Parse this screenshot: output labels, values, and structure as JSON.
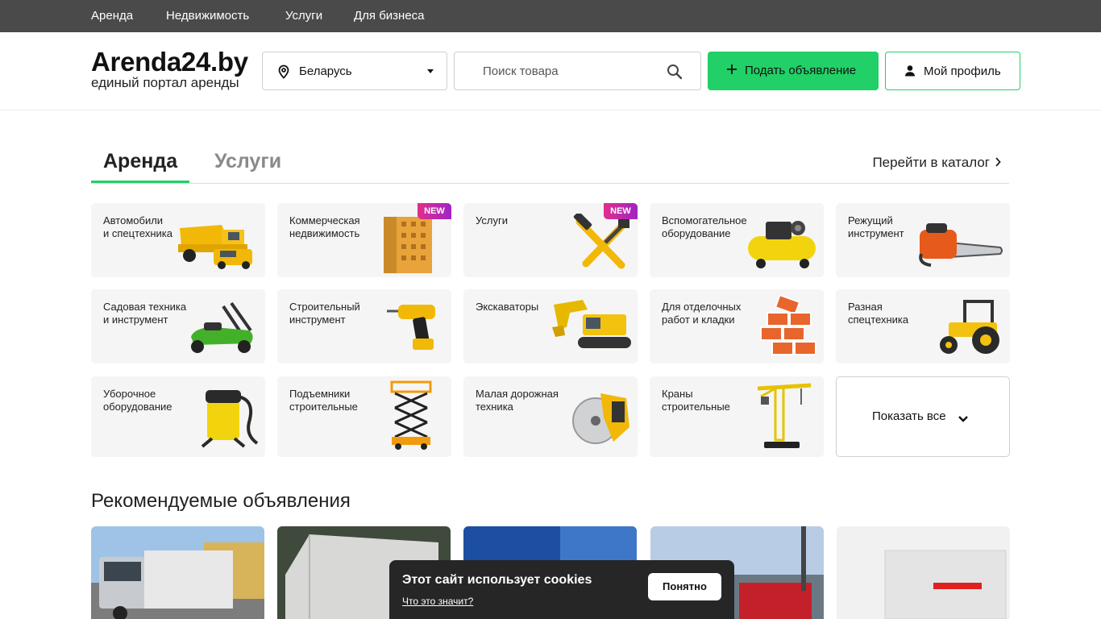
{
  "topnav": {
    "items": [
      "Аренда",
      "Недвижимость",
      "Услуги",
      "Для бизнеса"
    ]
  },
  "header": {
    "logo_title": "Arenda24.by",
    "logo_subtitle": "единый портал аренды",
    "region": "Беларусь",
    "search_placeholder": "Поиск товара",
    "post_button": "Подать объявление",
    "profile_button": "Мой профиль"
  },
  "tabs": {
    "items": [
      "Аренда",
      "Услуги"
    ],
    "active": "Аренда",
    "catalog_link": "Перейти в каталог"
  },
  "categories": [
    {
      "label": "Автомобили\nи спецтехника",
      "icon": "dump-truck-icon",
      "badge": ""
    },
    {
      "label": "Коммерческая\nнедвижимость",
      "icon": "building-icon",
      "badge": "NEW"
    },
    {
      "label": "Услуги",
      "icon": "tools-icon",
      "badge": "NEW"
    },
    {
      "label": "Вспомогательное\nоборудование",
      "icon": "compressor-icon",
      "badge": ""
    },
    {
      "label": "Режущий\nинструмент",
      "icon": "chainsaw-icon",
      "badge": ""
    },
    {
      "label": "Садовая техника\nи инструмент",
      "icon": "lawn-mower-icon",
      "badge": ""
    },
    {
      "label": "Строительный\nинструмент",
      "icon": "drill-icon",
      "badge": ""
    },
    {
      "label": "Экскаваторы",
      "icon": "excavator-icon",
      "badge": ""
    },
    {
      "label": "Для отделочных\nработ и кладки",
      "icon": "bricks-icon",
      "badge": ""
    },
    {
      "label": "Разная\nспецтехника",
      "icon": "tractor-icon",
      "badge": ""
    },
    {
      "label": "Уборочное\nоборудование",
      "icon": "vacuum-icon",
      "badge": ""
    },
    {
      "label": "Подъемники\nстроительные",
      "icon": "scissor-lift-icon",
      "badge": ""
    },
    {
      "label": "Малая дорожная\nтехника",
      "icon": "road-saw-icon",
      "badge": ""
    },
    {
      "label": "Краны\nстроительные",
      "icon": "tower-crane-icon",
      "badge": ""
    }
  ],
  "show_all": "Показать все",
  "recommended": {
    "title": "Рекомендуемые объявления"
  },
  "cookie": {
    "title": "Этот сайт использует cookies",
    "link": "Что это значит?",
    "button": "Понятно"
  },
  "colors": {
    "accent": "#21d067",
    "topbar": "#4a4a4a",
    "card_bg": "#f5f5f5",
    "badge_from": "#e02f8c",
    "badge_to": "#a024c4"
  }
}
